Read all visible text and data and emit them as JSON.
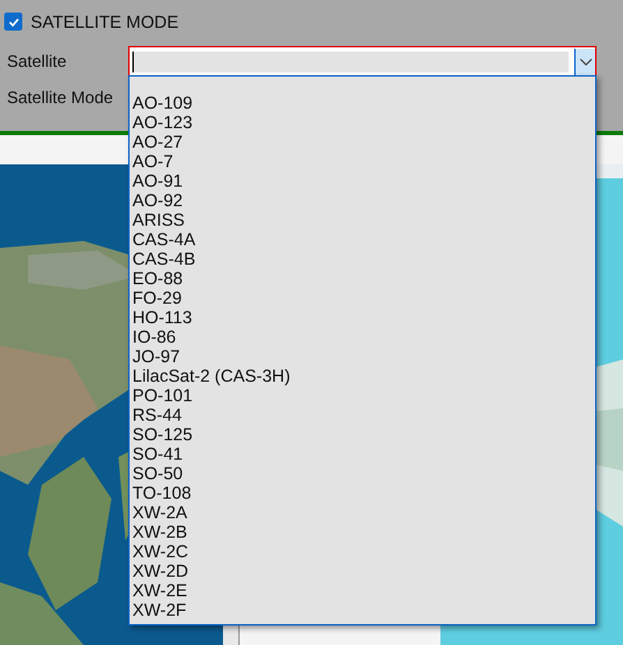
{
  "mode_checkbox": {
    "label": "SATELLITE MODE",
    "checked": true
  },
  "satellite_field": {
    "label": "Satellite",
    "expanded": true,
    "options": [
      "AO-109",
      "AO-123",
      "AO-27",
      "AO-7",
      "AO-91",
      "AO-92",
      "ARISS",
      "CAS-4A",
      "CAS-4B",
      "EO-88",
      "FO-29",
      "HO-113",
      "IO-86",
      "JO-97",
      "LilacSat-2 (CAS-3H)",
      "PO-101",
      "RS-44",
      "SO-125",
      "SO-41",
      "SO-50",
      "TO-108",
      "XW-2A",
      "XW-2B",
      "XW-2C",
      "XW-2D",
      "XW-2E",
      "XW-2F"
    ]
  },
  "satellite_mode_field": {
    "label": "Satellite Mode"
  }
}
